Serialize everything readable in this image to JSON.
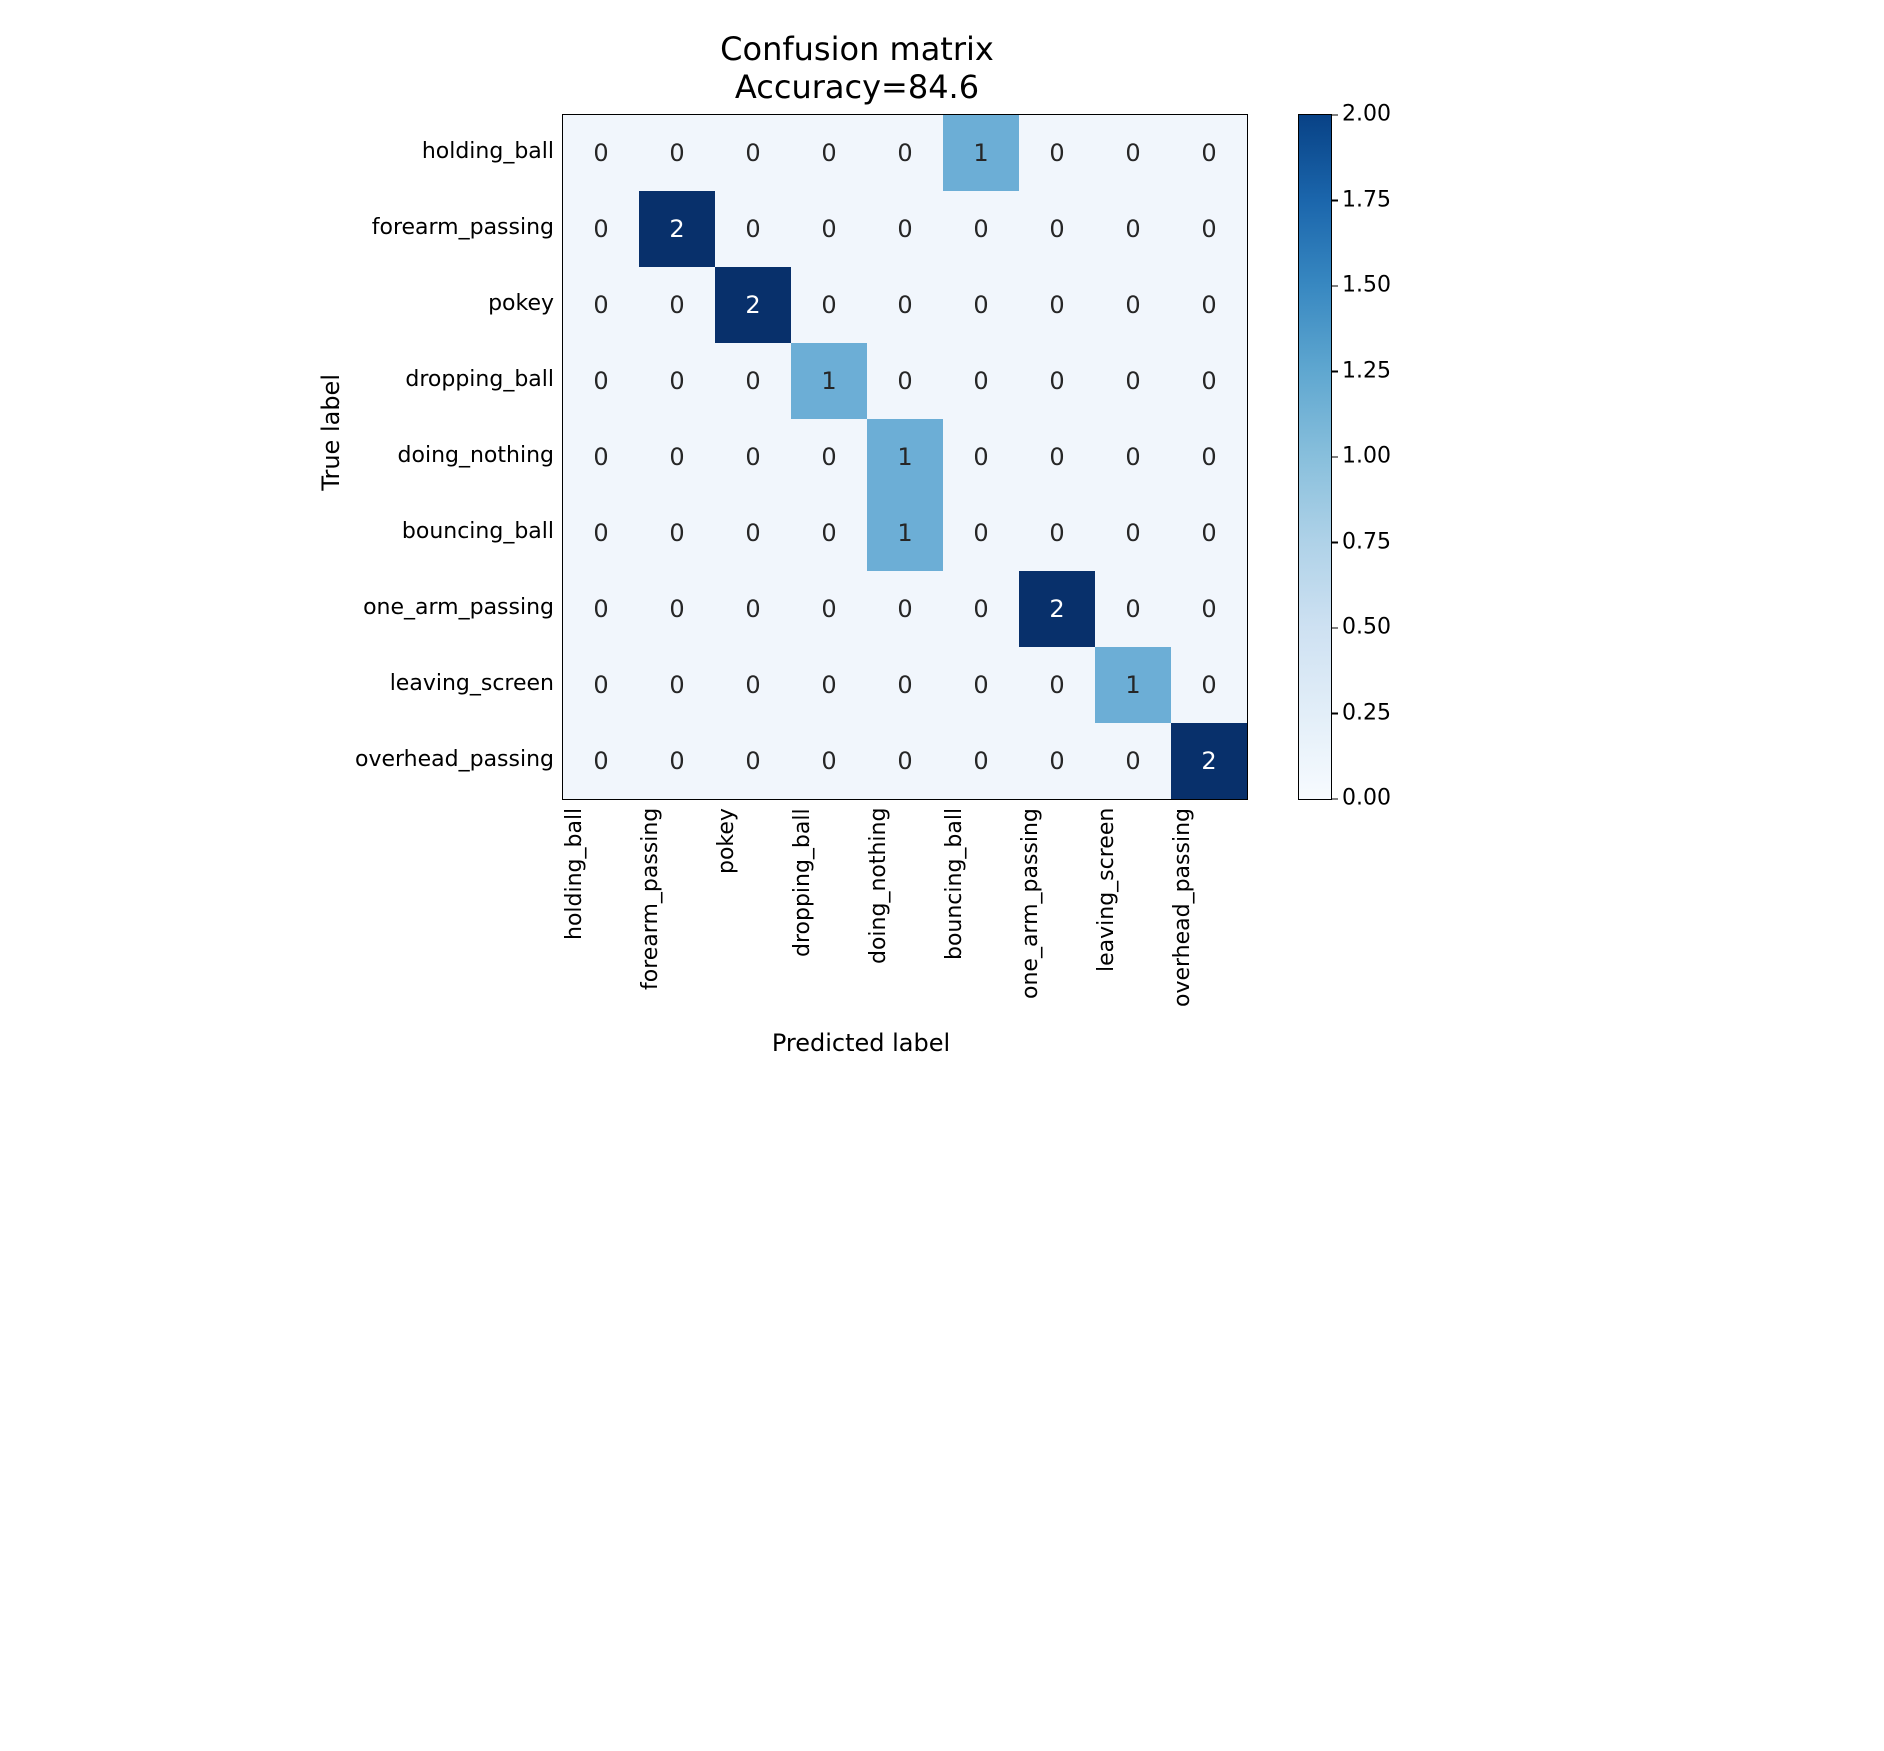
{
  "chart_data": {
    "type": "heatmap",
    "title": "Confusion matrix",
    "subtitle": "Accuracy=84.6",
    "xlabel": "Predicted label",
    "ylabel": "True label",
    "x_categories": [
      "holding_ball",
      "forearm_passing",
      "pokey",
      "dropping_ball",
      "doing_nothing",
      "bouncing_ball",
      "one_arm_passing",
      "leaving_screen",
      "overhead_passing"
    ],
    "y_categories": [
      "holding_ball",
      "forearm_passing",
      "pokey",
      "dropping_ball",
      "doing_nothing",
      "bouncing_ball",
      "one_arm_passing",
      "leaving_screen",
      "overhead_passing"
    ],
    "matrix": [
      [
        0,
        0,
        0,
        0,
        0,
        1,
        0,
        0,
        0
      ],
      [
        0,
        2,
        0,
        0,
        0,
        0,
        0,
        0,
        0
      ],
      [
        0,
        0,
        2,
        0,
        0,
        0,
        0,
        0,
        0
      ],
      [
        0,
        0,
        0,
        1,
        0,
        0,
        0,
        0,
        0
      ],
      [
        0,
        0,
        0,
        0,
        1,
        0,
        0,
        0,
        0
      ],
      [
        0,
        0,
        0,
        0,
        1,
        0,
        0,
        0,
        0
      ],
      [
        0,
        0,
        0,
        0,
        0,
        0,
        2,
        0,
        0
      ],
      [
        0,
        0,
        0,
        0,
        0,
        0,
        0,
        1,
        0
      ],
      [
        0,
        0,
        0,
        0,
        0,
        0,
        0,
        0,
        2
      ]
    ],
    "colorbar": {
      "vmin": 0.0,
      "vmax": 2.0,
      "ticks": [
        0.0,
        0.25,
        0.5,
        0.75,
        1.0,
        1.25,
        1.5,
        1.75,
        2.0
      ],
      "tick_labels": [
        "0.00",
        "0.25",
        "0.50",
        "0.75",
        "1.00",
        "1.25",
        "1.50",
        "1.75",
        "2.00"
      ]
    },
    "value_colors": {
      "0": "#f1f6fc",
      "1": "#6caed6",
      "2": "#08306b"
    },
    "light_text_threshold": 1.5
  }
}
